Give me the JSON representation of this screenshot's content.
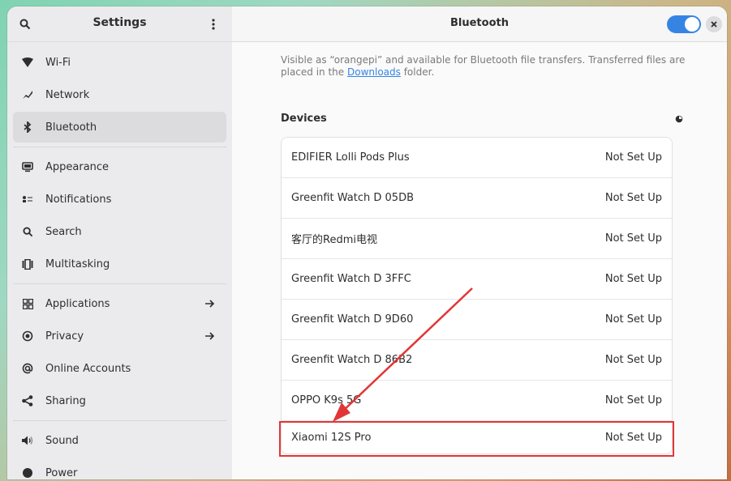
{
  "sidebar": {
    "title": "Settings",
    "items": [
      {
        "label": "Wi-Fi",
        "icon": "wifi-icon"
      },
      {
        "label": "Network",
        "icon": "network-icon"
      },
      {
        "label": "Bluetooth",
        "icon": "bluetooth-icon",
        "active": true
      },
      {
        "label": "Appearance",
        "icon": "appearance-icon"
      },
      {
        "label": "Notifications",
        "icon": "notifications-icon"
      },
      {
        "label": "Search",
        "icon": "search-icon"
      },
      {
        "label": "Multitasking",
        "icon": "multitasking-icon"
      },
      {
        "label": "Applications",
        "icon": "applications-icon",
        "arrow": true
      },
      {
        "label": "Privacy",
        "icon": "privacy-icon",
        "arrow": true
      },
      {
        "label": "Online Accounts",
        "icon": "online-accounts-icon"
      },
      {
        "label": "Sharing",
        "icon": "sharing-icon"
      },
      {
        "label": "Sound",
        "icon": "sound-icon"
      },
      {
        "label": "Power",
        "icon": "power-icon"
      }
    ]
  },
  "main": {
    "title": "Bluetooth",
    "toggle_on": true,
    "info_prefix": "Visible as “orangepi” and available for Bluetooth file transfers. Transferred files are placed in the ",
    "info_link": "Downloads",
    "info_suffix": " folder.",
    "devices_title": "Devices",
    "devices": [
      {
        "name": "EDIFIER Lolli Pods Plus",
        "status": "Not Set Up"
      },
      {
        "name": "Greenfit Watch D 05DB",
        "status": "Not Set Up"
      },
      {
        "name": "客厅的Redmi电视",
        "status": "Not Set Up"
      },
      {
        "name": "Greenfit Watch D 3FFC",
        "status": "Not Set Up"
      },
      {
        "name": "Greenfit Watch D 9D60",
        "status": "Not Set Up"
      },
      {
        "name": "Greenfit Watch D 86B2",
        "status": "Not Set Up"
      },
      {
        "name": "OPPO K9s 5G",
        "status": "Not Set Up"
      },
      {
        "name": "Xiaomi 12S Pro",
        "status": "Not Set Up",
        "highlighted": true
      }
    ]
  },
  "colors": {
    "accent": "#3584e4",
    "annotation": "#e23636"
  }
}
